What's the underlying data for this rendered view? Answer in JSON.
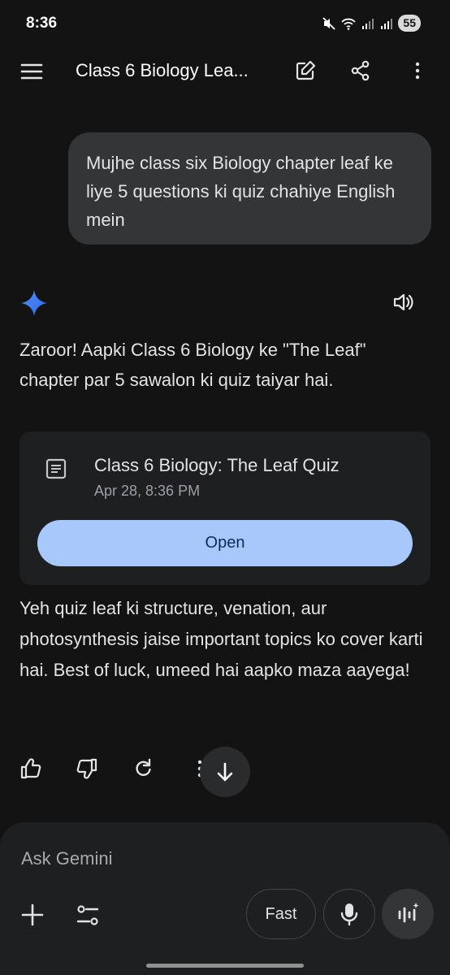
{
  "status_bar": {
    "time": "8:36",
    "battery": "55"
  },
  "header": {
    "title": "Class 6 Biology Lea..."
  },
  "user_message": {
    "text": "Mujhe class six Biology chapter leaf ke liye 5 questions ki quiz chahiye English mein"
  },
  "response": {
    "intro": "Zaroor! Aapki Class 6 Biology ke \"The Leaf\" chapter par 5 sawalon ki quiz taiyar hai.",
    "card": {
      "title": "Class 6 Biology: The Leaf Quiz",
      "date": "Apr 28, 8:36 PM",
      "open_label": "Open"
    },
    "outro": "Yeh quiz leaf ki structure, venation, aur photosynthesis jaise important topics ko cover karti hai. Best of luck, umeed hai aapko maza aayega!"
  },
  "input": {
    "placeholder": "Ask Gemini",
    "mode_label": "Fast"
  },
  "colors": {
    "background": "#131314",
    "bubble": "#333537",
    "card": "#1e1f20",
    "open_button": "#a8c7fa",
    "accent": "#4285f4"
  },
  "icons": [
    "menu-icon",
    "edit-icon",
    "share-icon",
    "more-vert-icon",
    "gemini-spark-icon",
    "speaker-icon",
    "document-icon",
    "thumbs-up-icon",
    "thumbs-down-icon",
    "regenerate-icon",
    "more-vert-icon",
    "arrow-down-icon",
    "plus-icon",
    "tools-icon",
    "mic-icon",
    "live-icon"
  ]
}
